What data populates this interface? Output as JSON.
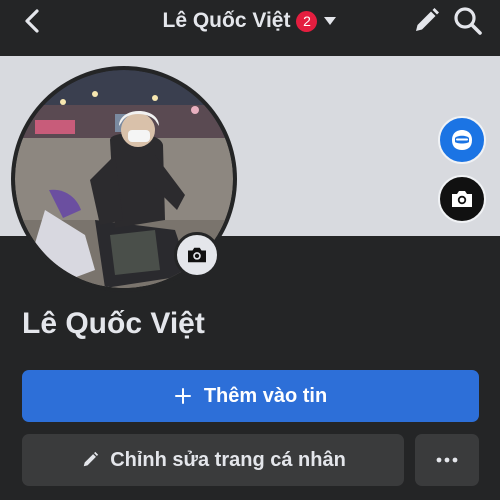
{
  "header": {
    "title": "Lê Quốc Việt",
    "badge_count": "2",
    "icons": {
      "back": "chevron-left-icon",
      "dropdown": "caret-down-icon",
      "edit": "pencil-icon",
      "search": "search-icon"
    }
  },
  "cover": {
    "icons": {
      "avatar": "avatar-icon",
      "camera": "camera-icon"
    }
  },
  "profile": {
    "name": "Lê Quốc Việt",
    "avatar_camera_icon": "camera-icon"
  },
  "actions": {
    "add_to_story": "Thêm vào tin",
    "edit_profile": "Chỉnh sửa trang cá nhân",
    "more": "more-horizontal-icon"
  },
  "colors": {
    "background": "#242526",
    "cover": "#d8dadf",
    "primary": "#2d6fd8",
    "secondary_button": "#3a3b3c",
    "badge": "#e41e3f"
  }
}
